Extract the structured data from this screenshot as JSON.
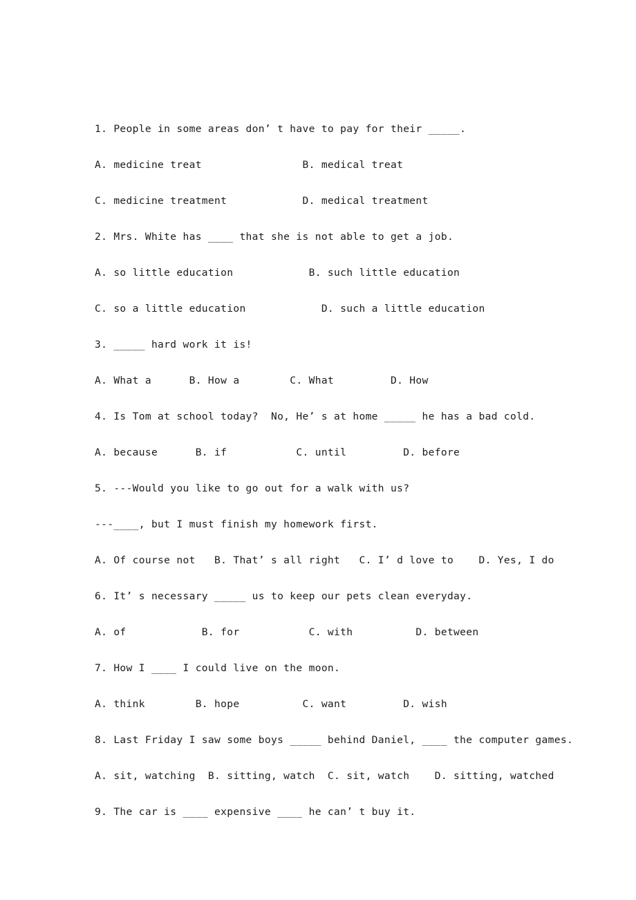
{
  "document": {
    "page_background": "#ffffff",
    "text_color": "#1c1c1c",
    "type": "scanned-worksheet",
    "title_visible": false,
    "lines": [
      {
        "id": "q1-stem",
        "kind": "question",
        "number": "1",
        "text": "1. People in some areas don’ t have to pay for their _____."
      },
      {
        "id": "q1-opt-ab",
        "kind": "options",
        "number": "1",
        "text": "A. medicine treat                B. medical treat"
      },
      {
        "id": "q1-opt-cd",
        "kind": "options",
        "number": "1",
        "text": "C. medicine treatment            D. medical treatment"
      },
      {
        "id": "q2-stem",
        "kind": "question",
        "number": "2",
        "text": "2. Mrs. White has ____ that she is not able to get a job."
      },
      {
        "id": "q2-opt-ab",
        "kind": "options",
        "number": "2",
        "text": "A. so little education            B. such little education"
      },
      {
        "id": "q2-opt-cd",
        "kind": "options",
        "number": "2",
        "text": "C. so a little education            D. such a little education"
      },
      {
        "id": "q3-stem",
        "kind": "question",
        "number": "3",
        "text": "3. _____ hard work it is!"
      },
      {
        "id": "q3-opt",
        "kind": "options",
        "number": "3",
        "text": "A. What a      B. How a        C. What         D. How"
      },
      {
        "id": "q4-stem",
        "kind": "question",
        "number": "4",
        "text": "4. Is Tom at school today?  No, He’ s at home _____ he has a bad cold."
      },
      {
        "id": "q4-opt",
        "kind": "options",
        "number": "4",
        "text": "A. because      B. if           C. until         D. before"
      },
      {
        "id": "q5-stem-a",
        "kind": "question",
        "number": "5",
        "text": "5. ---Would you like to go out for a walk with us?"
      },
      {
        "id": "q5-stem-b",
        "kind": "question",
        "number": "5",
        "text": "---____, but I must finish my homework first."
      },
      {
        "id": "q5-opt",
        "kind": "options",
        "number": "5",
        "text": "A. Of course not   B. That’ s all right   C. I’ d love to    D. Yes, I do"
      },
      {
        "id": "q6-stem",
        "kind": "question",
        "number": "6",
        "text": "6. It’ s necessary _____ us to keep our pets clean everyday."
      },
      {
        "id": "q6-opt",
        "kind": "options",
        "number": "6",
        "text": "A. of            B. for           C. with          D. between"
      },
      {
        "id": "q7-stem",
        "kind": "question",
        "number": "7",
        "text": "7. How I ____ I could live on the moon."
      },
      {
        "id": "q7-opt",
        "kind": "options",
        "number": "7",
        "text": "A. think        B. hope          C. want         D. wish"
      },
      {
        "id": "q8-stem",
        "kind": "question",
        "number": "8",
        "text": "8. Last Friday I saw some boys _____ behind Daniel, ____ the computer games."
      },
      {
        "id": "q8-opt",
        "kind": "options",
        "number": "8",
        "text": "A. sit, watching  B. sitting, watch  C. sit, watch    D. sitting, watched"
      },
      {
        "id": "q9-stem",
        "kind": "question",
        "number": "9",
        "text": "9. The car is ____ expensive ____ he can’ t buy it."
      }
    ]
  }
}
